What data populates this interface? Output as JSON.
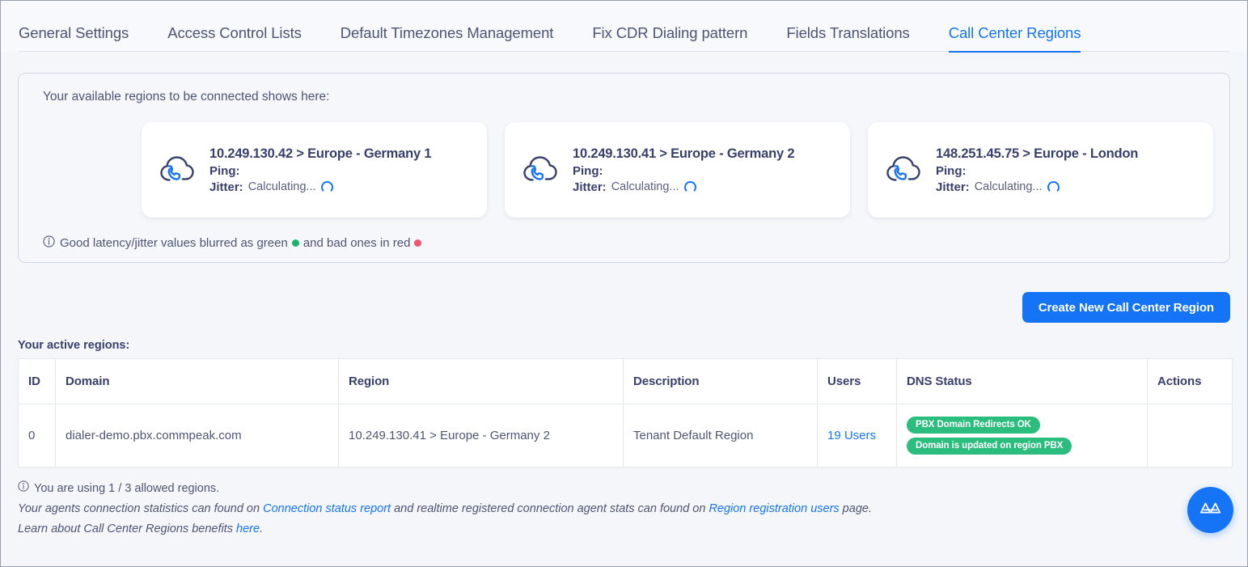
{
  "tabs": [
    {
      "label": "General Settings",
      "active": false
    },
    {
      "label": "Access Control Lists",
      "active": false
    },
    {
      "label": "Default Timezones Management",
      "active": false
    },
    {
      "label": "Fix CDR Dialing pattern",
      "active": false
    },
    {
      "label": "Fields Translations",
      "active": false
    },
    {
      "label": "Call Center Regions",
      "active": true
    }
  ],
  "available_panel": {
    "title": "Your available regions to be connected shows here:",
    "cards": [
      {
        "title": "10.249.130.42 > Europe - Germany 1",
        "ping_label": "Ping:",
        "ping_value": "",
        "jitter_label": "Jitter:",
        "jitter_value": "Calculating...",
        "icon": "cloud-phone-icon"
      },
      {
        "title": "10.249.130.41 > Europe - Germany 2",
        "ping_label": "Ping:",
        "ping_value": "",
        "jitter_label": "Jitter:",
        "jitter_value": "Calculating...",
        "icon": "cloud-phone-icon"
      },
      {
        "title": "148.251.45.75 > Europe - London",
        "ping_label": "Ping:",
        "ping_value": "",
        "jitter_label": "Jitter:",
        "jitter_value": "Calculating...",
        "icon": "cloud-phone-icon"
      }
    ],
    "legend": {
      "part1": "Good latency/jitter values blurred as green",
      "part2": "and bad ones in red",
      "green_color": "#17b46a",
      "red_color": "#f2546b",
      "icon": "info-circle-icon"
    }
  },
  "create_button": {
    "label": "Create New Call Center Region",
    "color": "#1574f5"
  },
  "table": {
    "label": "Your active regions:",
    "columns": [
      "ID",
      "Domain",
      "Region",
      "Description",
      "Users",
      "DNS Status",
      "Actions"
    ],
    "rows": [
      {
        "id": "0",
        "domain": "dialer-demo.pbx.commpeak.com",
        "region": "10.249.130.41 > Europe - Germany 2",
        "description": "Tenant Default Region",
        "users": "19 Users",
        "dns_status": [
          "PBX Domain Redirects OK",
          "Domain is updated on region PBX"
        ],
        "actions": ""
      }
    ]
  },
  "footer": {
    "usage": "You are using 1 / 3 allowed regions.",
    "usage_icon": "info-circle-icon",
    "line2_a": "Your agents connection statistics can found on ",
    "line2_link1": "Connection status report",
    "line2_b": " and realtime registered connection agent stats can found on ",
    "line2_link2": "Region registration users",
    "line2_c": " page.",
    "line3_a": "Learn about Call Center Regions benefits ",
    "line3_link": "here",
    "line3_b": "."
  },
  "fab": {
    "icon": "mountains-logo-icon",
    "color": "#1574f5"
  }
}
